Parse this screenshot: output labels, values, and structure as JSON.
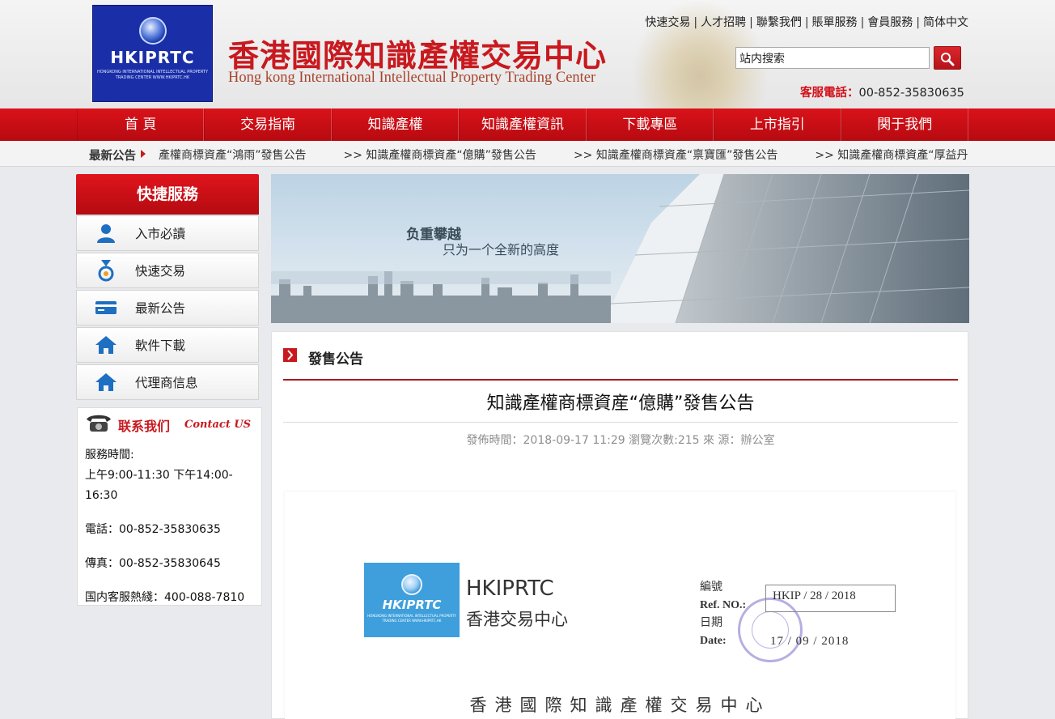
{
  "header": {
    "logo_text": "HKIPRTC",
    "logo_subtext": "HONGKONG INTERNATIONAL INTELLECTUAL PROPERTY TRADING CENTER WWW.HKIPRTC.HK",
    "site_title": "香港國際知識產權交易中心",
    "site_subtitle": "Hong kong International Intellectual Property Trading Center",
    "top_links": [
      "快速交易",
      "人才招聘",
      "聯繫我們",
      "賬單服務",
      "會員服務",
      "简体中文"
    ],
    "search_value": "站内搜索",
    "hotline_label": "客服電話：",
    "hotline_number": "00-852-35830635"
  },
  "nav": {
    "items": [
      "首 頁",
      "交易指南",
      "知識產權",
      "知識產權資訊",
      "下載專區",
      "上市指引",
      "関于我們"
    ]
  },
  "notice": {
    "label": "最新公告",
    "items": [
      "產權商標資產“鴻雨”發售公告",
      ">> 知識產權商標資產“億購”發售公告",
      ">> 知識產權商標資產“禀寶匯”發售公告",
      ">> 知識產權商標資產“厚益丹”發售公告"
    ]
  },
  "sidebar": {
    "title": "快捷服務",
    "items": [
      {
        "label": "入市必讀",
        "icon": "user-icon"
      },
      {
        "label": "快速交易",
        "icon": "medal-icon"
      },
      {
        "label": "最新公告",
        "icon": "card-icon"
      },
      {
        "label": "軟件下載",
        "icon": "home-icon"
      },
      {
        "label": "代理商信息",
        "icon": "home-icon"
      }
    ],
    "contact": {
      "title_cn": "联系我们",
      "title_en": "Contact US",
      "hours_label": "服務時間:",
      "hours": "上午9:00-11:30 下午14:00-16:30",
      "phone": "電話：00-852-35830635",
      "fax": "傳真：00-852-35830645",
      "domestic": "国内客服熱綫：400-088-7810"
    }
  },
  "banner": {
    "slogan1": "负重攀越",
    "slogan2": "只为一个全新的高度"
  },
  "content": {
    "section_title": "發售公告",
    "article_title": "知識產權商標資産“億購”發售公告",
    "meta": "發佈時間：2018-09-17 11:29 瀏覽次數:215 來 源：辦公室",
    "document": {
      "logo_text": "HKIPRTC",
      "logo_subtext": "HONGKONG INTERNATIONAL INTELLECTUAL PROPERTY TRADING CENTER WWW.HKIPRTC.HK",
      "brand": "HKIPRTC",
      "brand_cn": "香港交易中心",
      "ref_label_cn": "編號",
      "ref_label_en": "Ref. NO.:",
      "ref_value": "HKIP / 28 / 2018",
      "date_label_cn": "日期",
      "date_label_en": "Date:",
      "date_value": "17  /  09 /  2018",
      "center_name": "香港國際知識產權交易中心"
    }
  },
  "colors": {
    "brand_red": "#c8191f",
    "nav_red": "#d9121a",
    "logo_blue": "#1a2ea8"
  }
}
